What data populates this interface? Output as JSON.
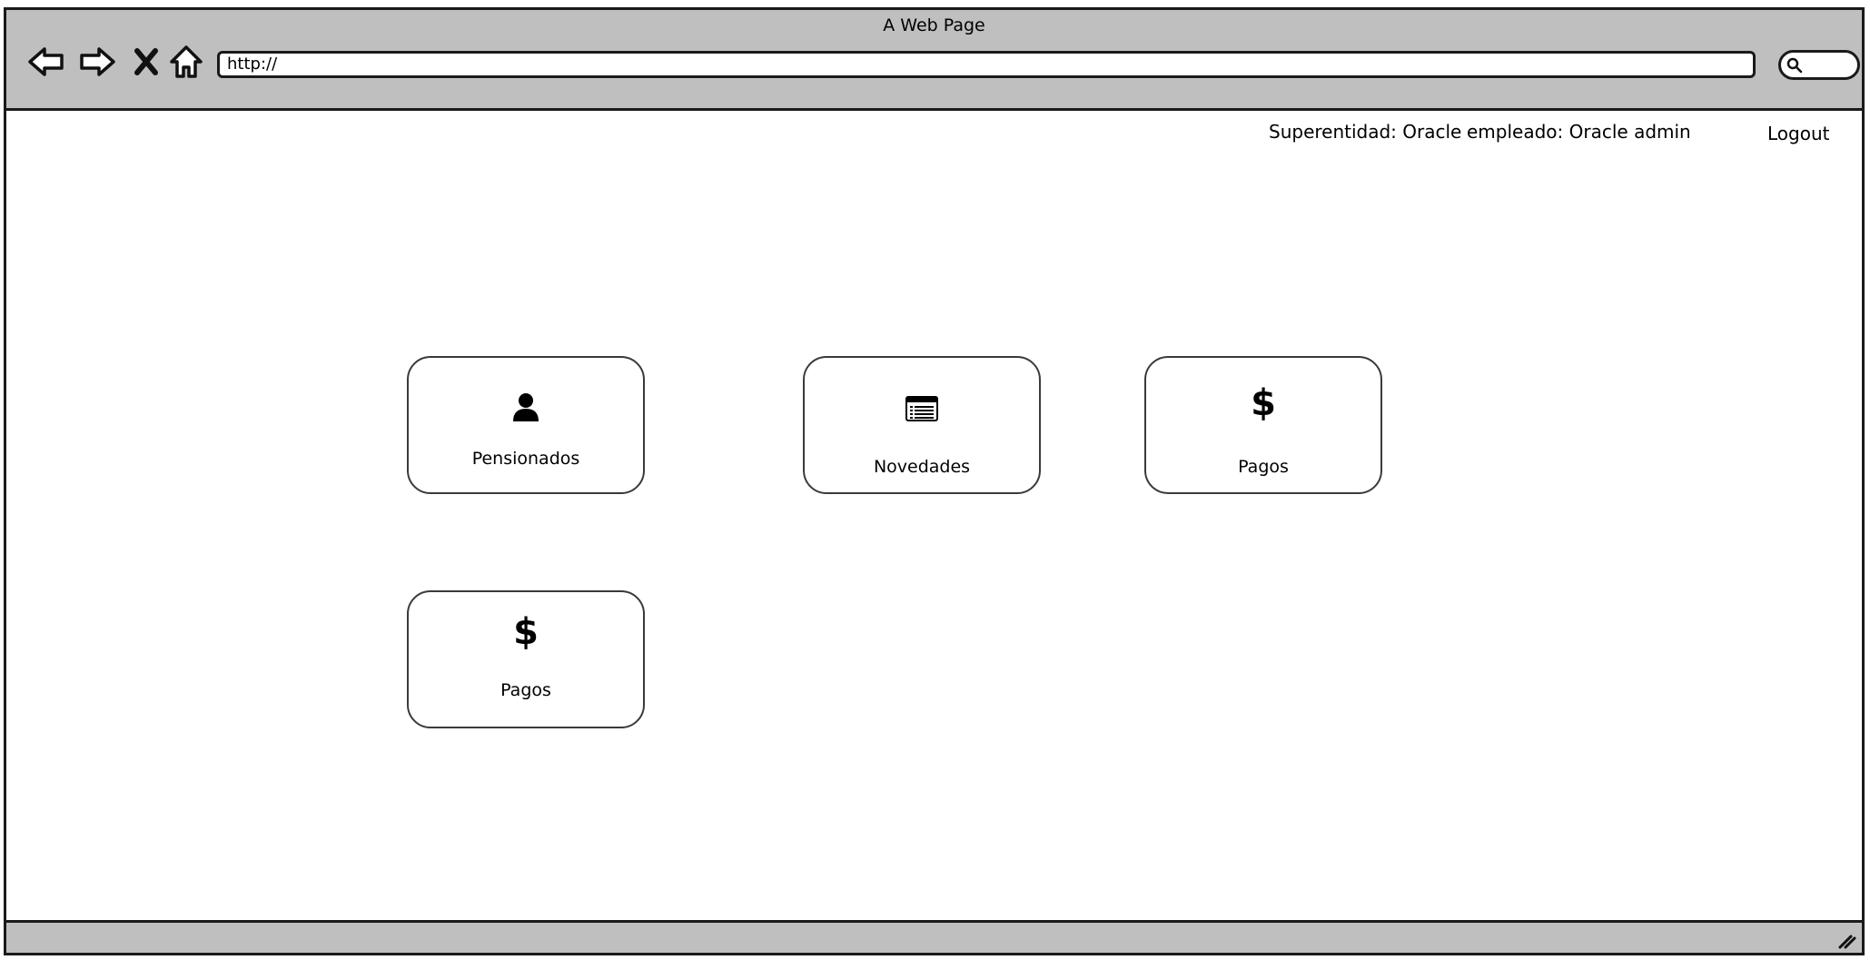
{
  "browser": {
    "title": "A Web Page",
    "url": "http://",
    "icons": [
      "back-arrow-icon",
      "forward-arrow-icon",
      "close-x-icon",
      "home-icon",
      "search-icon"
    ]
  },
  "header": {
    "superentidad": "Superentidad: Oracle",
    "empleado": "empleado: Oracle admin",
    "logout": "Logout"
  },
  "tiles": [
    {
      "label": "Pensionados",
      "icon": "user-icon"
    },
    {
      "label": "Novedades",
      "icon": "list-window-icon"
    },
    {
      "label": "Pagos",
      "icon": "dollar-icon",
      "glyph": "$"
    },
    {
      "label": "Pagos",
      "icon": "dollar-icon",
      "glyph": "$"
    }
  ]
}
